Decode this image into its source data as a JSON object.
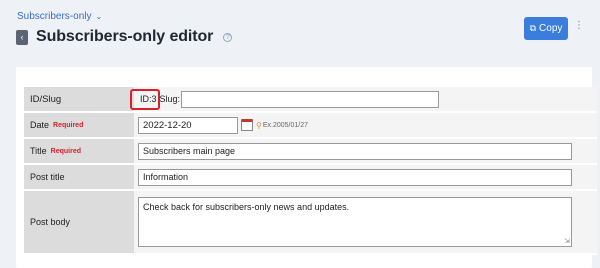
{
  "breadcrumb": {
    "label": "Subscribers-only"
  },
  "header": {
    "title": "Subscribers-only editor",
    "copy_label": "Copy"
  },
  "form": {
    "id_slug": {
      "label": "ID/Slug",
      "id_text": "ID:3",
      "slug_label": "Slug:",
      "slug_value": ""
    },
    "date": {
      "label": "Date",
      "required": "Required",
      "value": "2022-12-20",
      "hint": "Ex.2005/01/27"
    },
    "title": {
      "label": "Title",
      "required": "Required",
      "value": "Subscribers main page"
    },
    "post_title": {
      "label": "Post title",
      "value": "Information"
    },
    "post_body": {
      "label": "Post body",
      "value": "Check back for subscribers-only news and updates."
    }
  },
  "colors": {
    "accent": "#3b7ddd",
    "required": "#d9202a",
    "highlight": "#d9202a"
  }
}
